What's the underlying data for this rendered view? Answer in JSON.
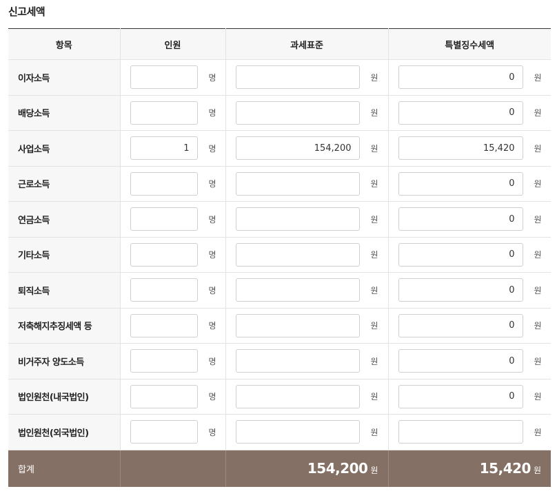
{
  "title": "신고세액",
  "headers": {
    "item": "항목",
    "count": "인원",
    "base": "과세표준",
    "tax": "특별징수세액"
  },
  "units": {
    "person": "명",
    "won": "원"
  },
  "rows": [
    {
      "label": "이자소득",
      "count": "",
      "base": "",
      "tax": "0"
    },
    {
      "label": "배당소득",
      "count": "",
      "base": "",
      "tax": "0"
    },
    {
      "label": "사업소득",
      "count": "1",
      "base": "154,200",
      "tax": "15,420"
    },
    {
      "label": "근로소득",
      "count": "",
      "base": "",
      "tax": "0"
    },
    {
      "label": "연금소득",
      "count": "",
      "base": "",
      "tax": "0"
    },
    {
      "label": "기타소득",
      "count": "",
      "base": "",
      "tax": "0"
    },
    {
      "label": "퇴직소득",
      "count": "",
      "base": "",
      "tax": "0"
    },
    {
      "label": "저축해지추징세액 등",
      "count": "",
      "base": "",
      "tax": "0"
    },
    {
      "label": "비거주자 양도소득",
      "count": "",
      "base": "",
      "tax": "0"
    },
    {
      "label": "법인원천(내국법인)",
      "count": "",
      "base": "",
      "tax": "0"
    },
    {
      "label": "법인원천(외국법인)",
      "count": "",
      "base": "",
      "tax": ""
    }
  ],
  "total": {
    "label": "합계",
    "base": "154,200",
    "tax": "15,420",
    "unit": "원"
  },
  "colors": {
    "total_bg": "#857066",
    "label_bg": "#f7f7f7"
  }
}
